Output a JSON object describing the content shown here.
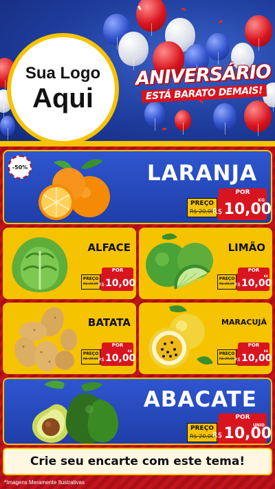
{
  "logo": {
    "line1": "Sua Logo",
    "line2": "Aqui"
  },
  "headline": {
    "title": "ANIVERSÁRIO",
    "subtitle": "ESTÁ BARATO DEMAIS!"
  },
  "colors": {
    "red": "#d8141e",
    "blue": "#2448c0",
    "yellow": "#f6c300"
  },
  "products": {
    "laranja": {
      "name": "LARANJA",
      "discount": "-50%",
      "preco_label": "PREÇO",
      "old_price": "R$ 20,00",
      "por_label": "POR",
      "currency": "R$",
      "price": "10,00",
      "unit": "KG",
      "icon": "orange-icon"
    },
    "alface": {
      "name": "ALFACE",
      "preco_label": "PREÇO",
      "old_price": "R$ 20,00",
      "por_label": "POR",
      "currency": "R$",
      "price": "10,00",
      "unit": "",
      "icon": "lettuce-icon"
    },
    "limao": {
      "name": "LIMÃO",
      "preco_label": "PREÇO",
      "old_price": "R$ 20,00",
      "por_label": "POR",
      "currency": "R$",
      "price": "10,00",
      "unit": "KG",
      "icon": "lime-icon"
    },
    "batata": {
      "name": "BATATA",
      "preco_label": "PREÇO",
      "old_price": "R$ 20,00",
      "por_label": "POR",
      "currency": "R$",
      "price": "10,00",
      "unit": "KG",
      "icon": "potato-icon"
    },
    "maracuja": {
      "name": "MARACUJÁ",
      "preco_label": "PREÇO",
      "old_price": "R$ 20,00",
      "por_label": "POR",
      "currency": "R$",
      "price": "10,00",
      "unit": "KG",
      "icon": "passion-fruit-icon"
    },
    "abacate": {
      "name": "ABACATE",
      "preco_label": "PREÇO",
      "old_price": "R$ 20,00",
      "por_label": "POR",
      "currency": "R$",
      "price": "10,00",
      "unit": "UNID",
      "icon": "avocado-icon"
    }
  },
  "cta": "Crie seu encarte com este tema!",
  "footnote": "*Imagens Meramente Ilustrativas"
}
